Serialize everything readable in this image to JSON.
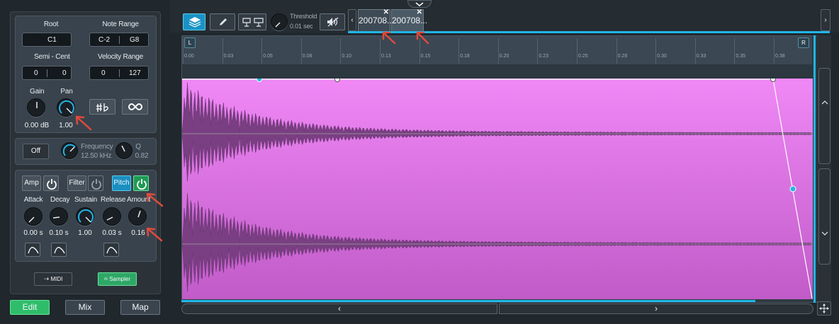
{
  "params": {
    "root_label": "Root",
    "root_value": "C1",
    "note_range_label": "Note Range",
    "note_range_low": "C-2",
    "note_range_high": "G8",
    "semi_cent_label": "Semi - Cent",
    "semi_value": "0",
    "cent_value": "0",
    "velocity_range_label": "Velocity Range",
    "velocity_low": "0",
    "velocity_high": "127",
    "gain_label": "Gain",
    "gain_value": "0.00 dB",
    "pan_label": "Pan",
    "pan_value": "1.00"
  },
  "filter_section": {
    "off_label": "Off",
    "frequency_label": "Frequency",
    "frequency_value": "12.50 kHz",
    "q_label": "Q",
    "q_value": "0.82"
  },
  "envelope": {
    "amp_label": "Amp",
    "filter_label": "Filter",
    "pitch_label": "Pitch",
    "attack_label": "Attack",
    "attack_value": "0.00 s",
    "decay_label": "Decay",
    "decay_value": "0.10 s",
    "sustain_label": "Sustain",
    "sustain_value": "1.00",
    "release_label": "Release",
    "release_value": "0.03 s",
    "amount_label": "Amount",
    "amount_value": "0.16"
  },
  "mode_buttons": {
    "midi_label": "MIDI",
    "sampler_label": "Sampler"
  },
  "bottom_tabs": [
    "Edit",
    "Mix",
    "Map"
  ],
  "toolbar": {
    "threshold_label": "Threshold",
    "threshold_value": "0.01 sec"
  },
  "sample_tabs": [
    "200708...",
    "200708..."
  ],
  "ruler": {
    "left_marker": "L",
    "right_marker": "R",
    "ticks": [
      "0.00",
      "0.03",
      "0.05",
      "0.08",
      "0.10",
      "0.13",
      "0.15",
      "0.18",
      "0.20",
      "0.23",
      "0.25",
      "0.28",
      "0.30",
      "0.33",
      "0.35",
      "0.38"
    ]
  },
  "colors": {
    "accent": "#1fb6e6",
    "waveform_fill": "#e882ef",
    "waveform_fill_bottom": "#c25fc9",
    "active_green": "#3fd77a",
    "annotation_red": "#e04a3c"
  }
}
